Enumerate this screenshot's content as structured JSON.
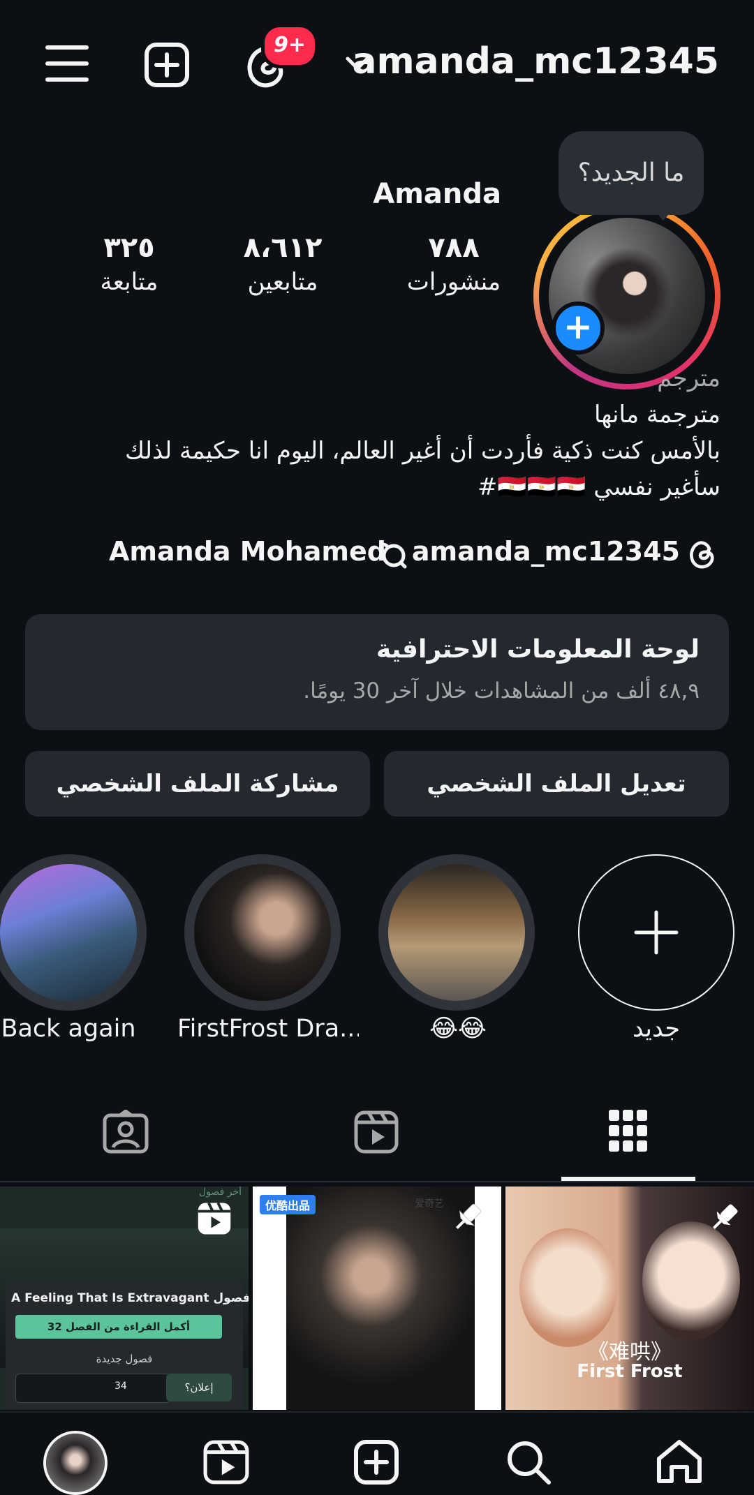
{
  "header": {
    "username": "amanda_mc12345",
    "notification_badge": "9+"
  },
  "tooltip": "ما الجديد؟",
  "profile": {
    "display_name": "Amanda",
    "stats": [
      {
        "value": "٧٨٨",
        "label": "منشورات"
      },
      {
        "value": "٨،٦١٢",
        "label": "متابعين"
      },
      {
        "value": "٣٢٥",
        "label": "متابعة"
      }
    ],
    "category": "مترجم",
    "bio_lines": [
      "مترجمة مانها",
      "بالأمس كنت ذكية فأردت أن أغير العالم، اليوم انا حكيمة لذلك",
      "سأغير نفسي 🇪🇬🇪🇬🇪🇬#"
    ],
    "threads_link": "amanda_mc12345",
    "linked_name": "Amanda Mohamed"
  },
  "dashboard": {
    "title": "لوحة المعلومات الاحترافية",
    "subtitle": "٤٨,٩ ألف من المشاهدات خلال آخر 30 يومًا."
  },
  "buttons": {
    "edit": "تعديل الملف الشخصي",
    "share": "مشاركة الملف الشخصي"
  },
  "highlights": [
    {
      "label": "Back again"
    },
    {
      "label": "FirstFrost Dra..."
    },
    {
      "label": "😂😂"
    },
    {
      "label": "جديد"
    }
  ],
  "posts": {
    "post1": {
      "header": "أخر فصول",
      "title": "A Feeling That Is Extravagant أخر فصول",
      "continue": "أكمل القراءة من الفصل 32",
      "new_chapters": "فصول جديدة",
      "chapter_num": "34",
      "ad": "إعلان؟"
    },
    "post2": {
      "tag": "优酷出品",
      "logo": "爱奇艺"
    },
    "post3": {
      "title_cn": "《难哄》",
      "title_en": "First Frost"
    }
  },
  "colors": {
    "background": "#0c1014",
    "surface": "#24292f",
    "accent_blue": "#1a8cff",
    "badge_red": "#ff2b4c"
  }
}
